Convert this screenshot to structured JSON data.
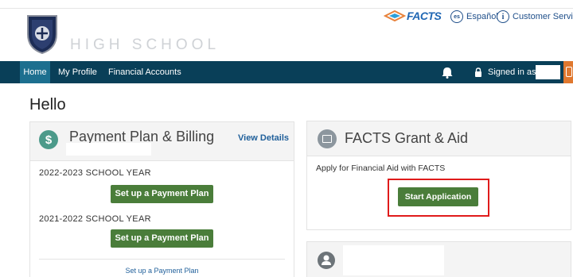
{
  "header": {
    "school_name": "HIGH SCHOOL",
    "crest_alt": "school crest",
    "brand": {
      "name": "FACTS",
      "color": "#1f66b3"
    },
    "language": {
      "badge": "es",
      "label": "Español"
    },
    "customer_service": {
      "icon": "info-icon",
      "label": "Customer Service"
    }
  },
  "nav": {
    "items": [
      {
        "label": "Home",
        "active": true
      },
      {
        "label": "My Profile",
        "active": false
      },
      {
        "label": "Financial Accounts",
        "active": false
      }
    ],
    "signed_in_label": "Signed in as",
    "bar_color": "#093f58",
    "accent_color": "#e0782f"
  },
  "page": {
    "greeting": "Hello"
  },
  "payment_card": {
    "title": "Payment Plan & Billing",
    "view_details": "View Details",
    "years": [
      {
        "label": "2022-2023 SCHOOL YEAR",
        "button": "Set up a Payment Plan"
      },
      {
        "label": "2021-2022 SCHOOL YEAR",
        "button": "Set up a Payment Plan"
      }
    ],
    "footer_link": "Set up a Payment Plan"
  },
  "grant_card": {
    "title": "FACTS Grant & Aid",
    "description": "Apply for Financial Aid with FACTS",
    "button": "Start Application",
    "highlight_color": "#e01b1b"
  },
  "icons": [
    "shield-icon",
    "bell-icon",
    "lock-icon",
    "logout-icon",
    "dollar-icon",
    "grant-document-icon",
    "person-icon"
  ],
  "colors": {
    "primary_button": "#4a7d3a",
    "link": "#1f5f9a"
  }
}
